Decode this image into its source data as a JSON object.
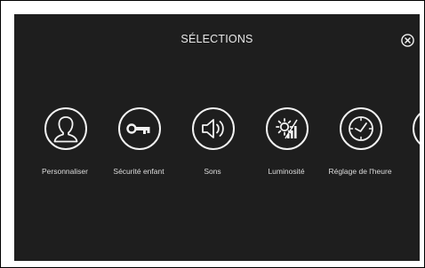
{
  "header": {
    "title": "SÉLECTIONS",
    "close_icon": "close-circle-icon"
  },
  "menu": {
    "items": [
      {
        "label": "Personnaliser",
        "icon": "user-profile-icon"
      },
      {
        "label": "Sécurité enfant",
        "icon": "key-icon"
      },
      {
        "label": "Sons",
        "icon": "speaker-icon"
      },
      {
        "label": "Luminosité",
        "icon": "brightness-icon"
      },
      {
        "label": "Réglage de l'heure",
        "icon": "clock-icon"
      },
      {
        "label": "",
        "icon": "partial-next-item-icon"
      }
    ]
  },
  "colors": {
    "background": "#1e1e1e",
    "foreground": "#f2f2f2",
    "frame": "#ffffff"
  }
}
